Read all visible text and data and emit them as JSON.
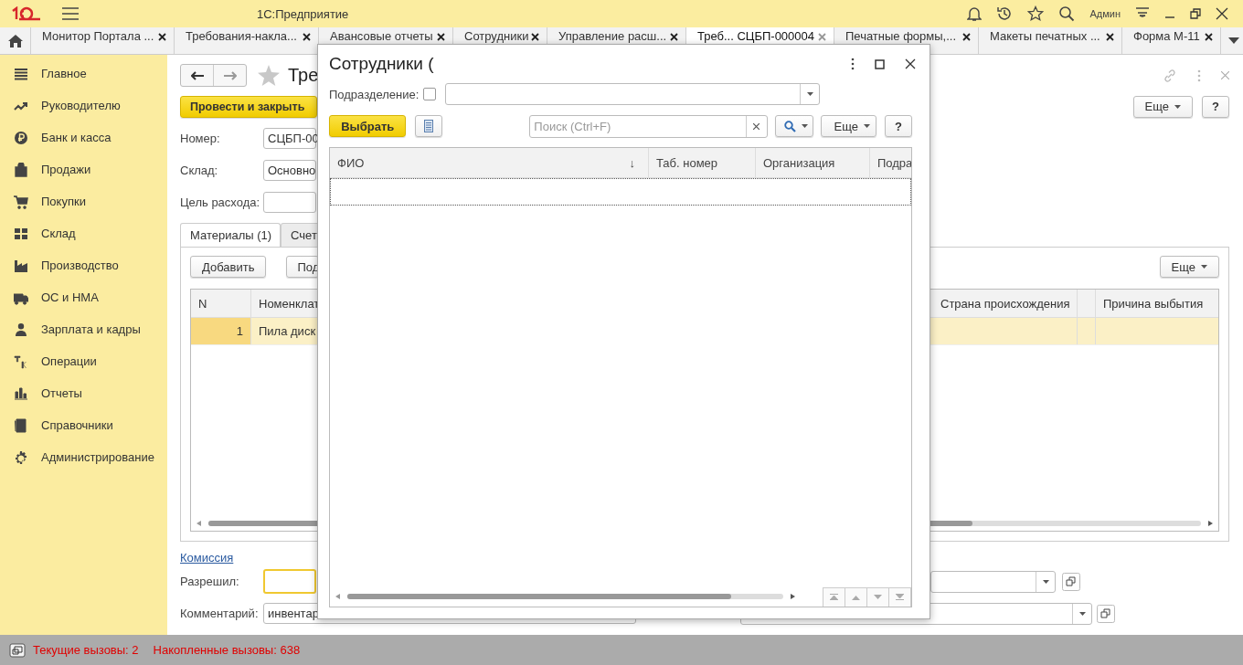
{
  "window": {
    "title": "1С:Предприятие",
    "user": "Админ"
  },
  "tabs": [
    {
      "label": "Монитор Портала ...",
      "selected": false
    },
    {
      "label": "Требования-накла...",
      "selected": false
    },
    {
      "label": "Авансовые отчеты",
      "selected": false
    },
    {
      "label": "Сотрудники",
      "selected": false
    },
    {
      "label": "Управление расш...",
      "selected": false
    },
    {
      "label": "Треб... СЦБП-000004",
      "selected": true
    },
    {
      "label": "Печатные формы,...",
      "selected": false
    },
    {
      "label": "Макеты печатных ...",
      "selected": false
    },
    {
      "label": "Форма М-11",
      "selected": false
    }
  ],
  "sidebar": {
    "items": [
      {
        "label": "Главное"
      },
      {
        "label": "Руководителю"
      },
      {
        "label": "Банк и касса"
      },
      {
        "label": "Продажи"
      },
      {
        "label": "Покупки"
      },
      {
        "label": "Склад"
      },
      {
        "label": "Производство"
      },
      {
        "label": "ОС и НМА"
      },
      {
        "label": "Зарплата и кадры"
      },
      {
        "label": "Операции"
      },
      {
        "label": "Отчеты"
      },
      {
        "label": "Справочники"
      },
      {
        "label": "Администрирование"
      }
    ]
  },
  "form": {
    "title": "Тре",
    "post_button": "Провести и закрыть",
    "more_button": "Еще",
    "help_button": "?",
    "fields": [
      {
        "label": "Номер:",
        "value": "СЦБП-00"
      },
      {
        "label": "Склад:",
        "value": "Основно"
      },
      {
        "label": "Цель расхода:"
      }
    ],
    "tabs": [
      {
        "label": "Материалы (1)",
        "selected": true
      },
      {
        "label": "Счет",
        "selected": false
      }
    ],
    "table": {
      "buttons": [
        "Добавить",
        "Под"
      ],
      "more_button": "Еще",
      "columns_left": [
        "N",
        "Номенклат"
      ],
      "columns_right": [
        "Страна происхождения",
        "Причина выбытия"
      ],
      "rows": [
        {
          "n": "1",
          "item": "Пила диск",
          "selected": true
        }
      ]
    },
    "commission_link": "Комиссия",
    "approved": {
      "label": "Разрешил:"
    },
    "comment": {
      "label": "Комментарий:",
      "value": "инвентар"
    }
  },
  "dialog": {
    "title": "Сотрудники (",
    "department": {
      "label": "Подразделение:",
      "checked": false
    },
    "select_button": "Выбрать",
    "search": {
      "placeholder": "Поиск (Ctrl+F)"
    },
    "more_button": "Еще",
    "help_button": "?",
    "columns": [
      {
        "label": "ФИО",
        "sort": "↓"
      },
      {
        "label": "Таб. номер"
      },
      {
        "label": "Организация"
      },
      {
        "label": "Подра"
      }
    ]
  },
  "status_bar": {
    "current": "Текущие вызовы: 2",
    "accumulated": "Накопленные вызовы: 638"
  }
}
